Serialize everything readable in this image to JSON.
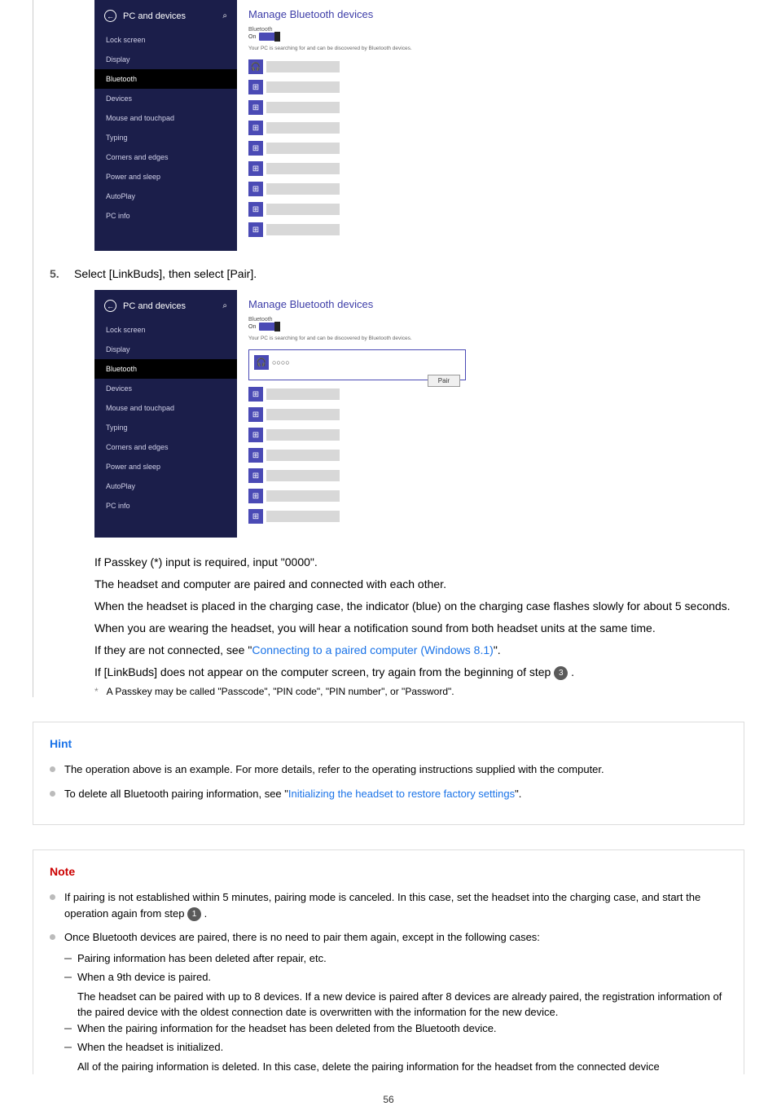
{
  "screenshot_a": {
    "sidebar_title": "PC and devices",
    "items": [
      "Lock screen",
      "Display",
      "Bluetooth",
      "Devices",
      "Mouse and touchpad",
      "Typing",
      "Corners and edges",
      "Power and sleep",
      "AutoPlay",
      "PC info"
    ],
    "active_index": 2,
    "content_title": "Manage Bluetooth devices",
    "bt_label": "Bluetooth",
    "bt_state": "On",
    "search_text": "Your PC is searching for and can be discovered by Bluetooth devices."
  },
  "step5": {
    "num": "5.",
    "text": "Select [LinkBuds], then select [Pair]."
  },
  "screenshot_b": {
    "sidebar_title": "PC and devices",
    "items": [
      "Lock screen",
      "Display",
      "Bluetooth",
      "Devices",
      "Mouse and touchpad",
      "Typing",
      "Corners and edges",
      "Power and sleep",
      "AutoPlay",
      "PC info"
    ],
    "active_index": 2,
    "content_title": "Manage Bluetooth devices",
    "bt_label": "Bluetooth",
    "bt_state": "On",
    "search_text": "Your PC is searching for and can be discovered by Bluetooth devices.",
    "selected_device": "○○○○",
    "pair_label": "Pair"
  },
  "paragraphs": {
    "p1": "If Passkey (*) input is required, input \"0000\".",
    "p2": "The headset and computer are paired and connected with each other.",
    "p3": "When the headset is placed in the charging case, the indicator (blue) on the charging case flashes slowly for about 5 seconds.",
    "p4": "When you are wearing the headset, you will hear a notification sound from both headset units at the same time.",
    "p5a": "If they are not connected, see \"",
    "p5_link": "Connecting to a paired computer (Windows 8.1)",
    "p5b": "\".",
    "p6a": "If [LinkBuds] does not appear on the computer screen, try again from the beginning of step ",
    "p6_badge": "3",
    "p6b": " ."
  },
  "footnote": {
    "mark": "*",
    "text": "A Passkey may be called \"Passcode\", \"PIN code\", \"PIN number\", or \"Password\"."
  },
  "hint": {
    "title": "Hint",
    "items": [
      {
        "text": "The operation above is an example. For more details, refer to the operating instructions supplied with the computer."
      },
      {
        "text_a": "To delete all Bluetooth pairing information, see \"",
        "link": "Initializing the headset to restore factory settings",
        "text_b": "\"."
      }
    ]
  },
  "note": {
    "title": "Note",
    "item1_a": "If pairing is not established within 5 minutes, pairing mode is canceled. In this case, set the headset into the charging case, and start the operation again from step ",
    "item1_badge": "1",
    "item1_b": " .",
    "item2": "Once Bluetooth devices are paired, there is no need to pair them again, except in the following cases:",
    "sub1": "Pairing information has been deleted after repair, etc.",
    "sub2": "When a 9th device is paired.",
    "sub2_detail": "The headset can be paired with up to 8 devices. If a new device is paired after 8 devices are already paired, the registration information of the paired device with the oldest connection date is overwritten with the information for the new device.",
    "sub3": "When the pairing information for the headset has been deleted from the Bluetooth device.",
    "sub4": "When the headset is initialized.",
    "sub4_detail": "All of the pairing information is deleted. In this case, delete the pairing information for the headset from the connected device"
  },
  "page_number": "56"
}
